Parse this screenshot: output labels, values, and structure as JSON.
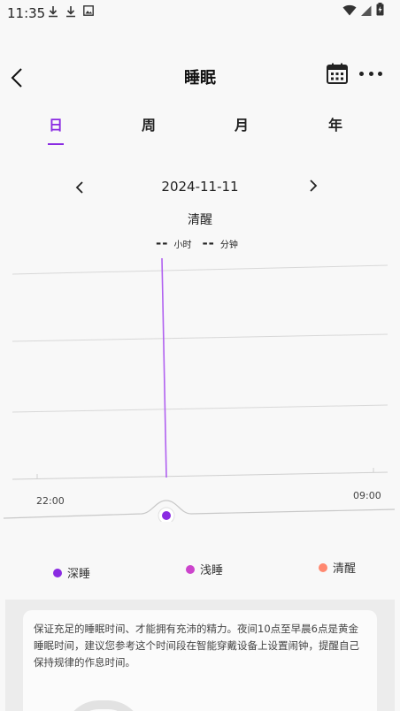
{
  "status_bar": {
    "time": "11:35",
    "left_icons": [
      "download-icon",
      "download-icon",
      "image-notification-icon"
    ],
    "right_icons": [
      "wifi-icon",
      "signal-icon",
      "battery-icon"
    ]
  },
  "header": {
    "title": "睡眠",
    "left_icon": "back-arrow-icon",
    "right_icons": [
      "calendar-icon",
      "more-icon"
    ]
  },
  "tabs": [
    {
      "label": "日",
      "active": true
    },
    {
      "label": "周",
      "active": false
    },
    {
      "label": "月",
      "active": false
    },
    {
      "label": "年",
      "active": false
    }
  ],
  "date_nav": {
    "date": "2024-11-11",
    "prev_icon": "chevron-left-icon",
    "next_icon": "chevron-right-icon"
  },
  "summary": {
    "state": "清醒",
    "hours": "--",
    "hours_unit": "小时",
    "minutes": "--",
    "minutes_unit": "分钟"
  },
  "chart": {
    "start_time": "22:00",
    "end_time": "09:00"
  },
  "legend": [
    {
      "label": "深睡",
      "color": "#8a2be2"
    },
    {
      "label": "浅睡",
      "color": "#cc44cc"
    },
    {
      "label": "清醒",
      "color": "#ff8870"
    }
  ],
  "colors": {
    "accent": "#8a2be2",
    "indicator_line": "#b060f0"
  },
  "info": {
    "text": "保证充足的睡眠时间、才能拥有充沛的精力。夜间10点至早晨6点是黄金睡眠时间，建议您参考这个时间段在智能穿戴设备上设置闹钟，提醒自己保持规律的作息时间。"
  }
}
